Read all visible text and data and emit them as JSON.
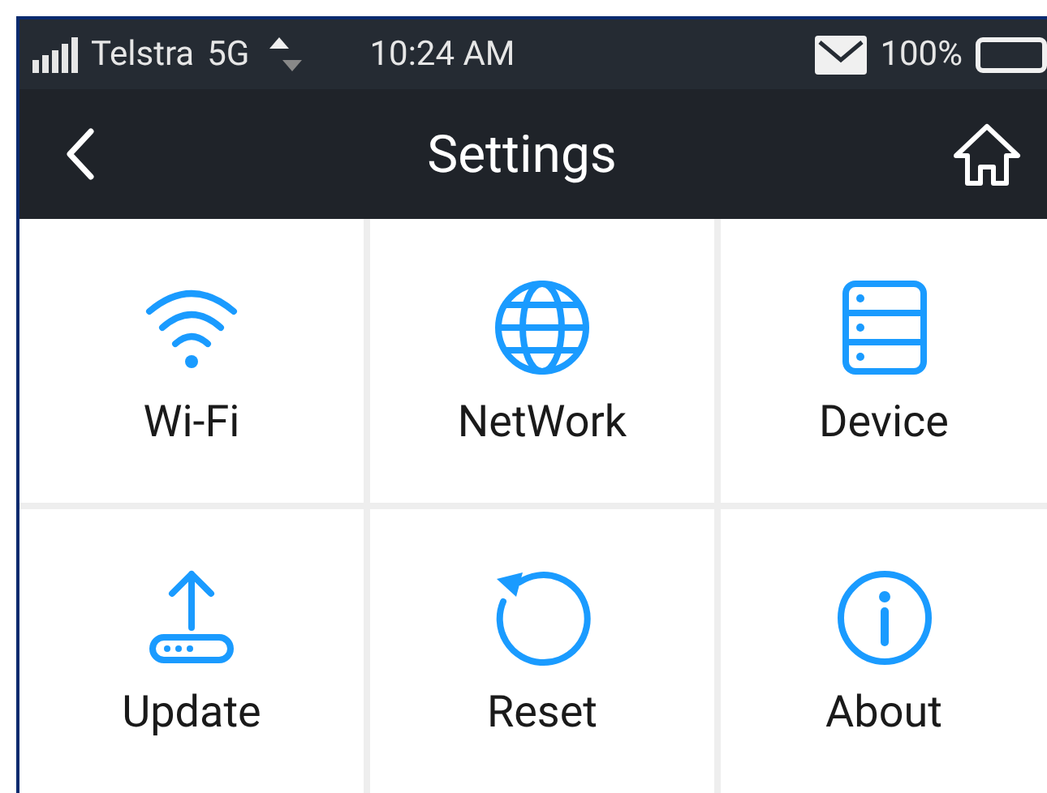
{
  "status_bar": {
    "carrier": "Telstra",
    "network": "5G",
    "time": "10:24 AM",
    "battery": "100%"
  },
  "header": {
    "title": "Settings"
  },
  "tiles": [
    {
      "label": "Wi-Fi",
      "kind": "wifi"
    },
    {
      "label": "NetWork",
      "kind": "network"
    },
    {
      "label": "Device",
      "kind": "device"
    },
    {
      "label": "Update",
      "kind": "update"
    },
    {
      "label": "Reset",
      "kind": "reset"
    },
    {
      "label": "About",
      "kind": "about"
    }
  ]
}
